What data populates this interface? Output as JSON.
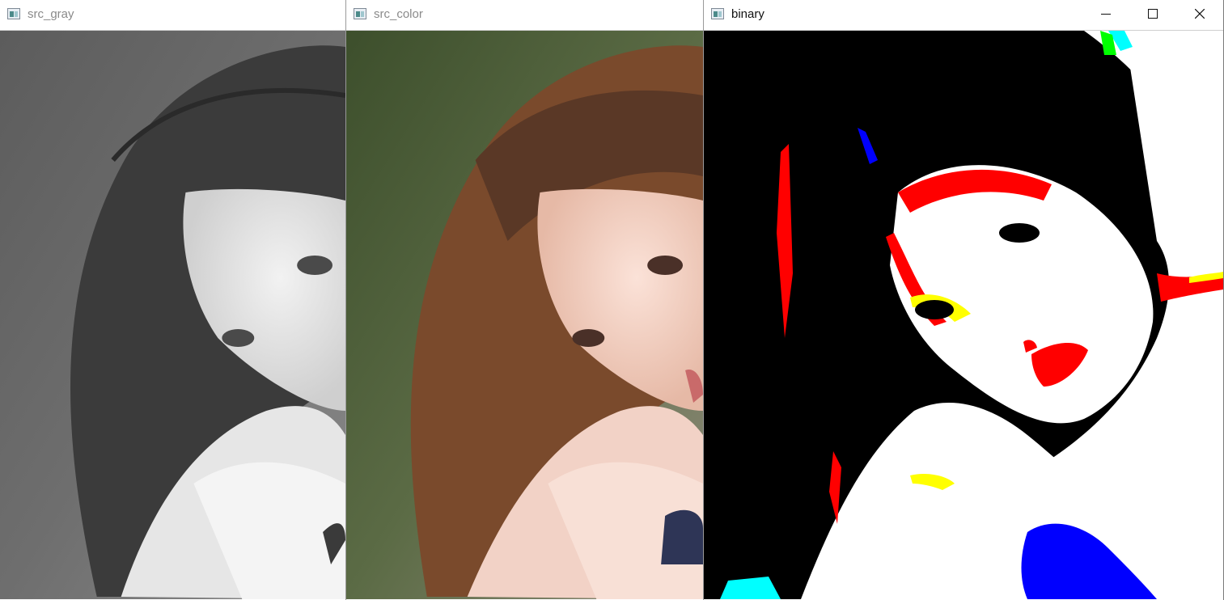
{
  "windows": [
    {
      "title": "src_gray",
      "icon": "opencv-window-icon",
      "active": false
    },
    {
      "title": "src_color",
      "icon": "opencv-window-icon",
      "active": false
    },
    {
      "title": "binary",
      "icon": "opencv-window-icon",
      "active": true
    }
  ],
  "window_controls": {
    "minimize_icon": "minimize-icon",
    "maximize_icon": "maximize-icon",
    "close_icon": "close-icon"
  },
  "images": {
    "src_gray": "grayscale portrait photo",
    "src_color": "color portrait photo",
    "binary": "thresholded binary image"
  },
  "colors": {
    "titlebar_bg": "#ffffff",
    "inactive_title": "#8a8a8a",
    "active_title": "#111111",
    "binary_red": "#ff0000",
    "binary_yellow": "#ffff00",
    "binary_blue": "#0000ff",
    "binary_cyan": "#00ffff"
  }
}
